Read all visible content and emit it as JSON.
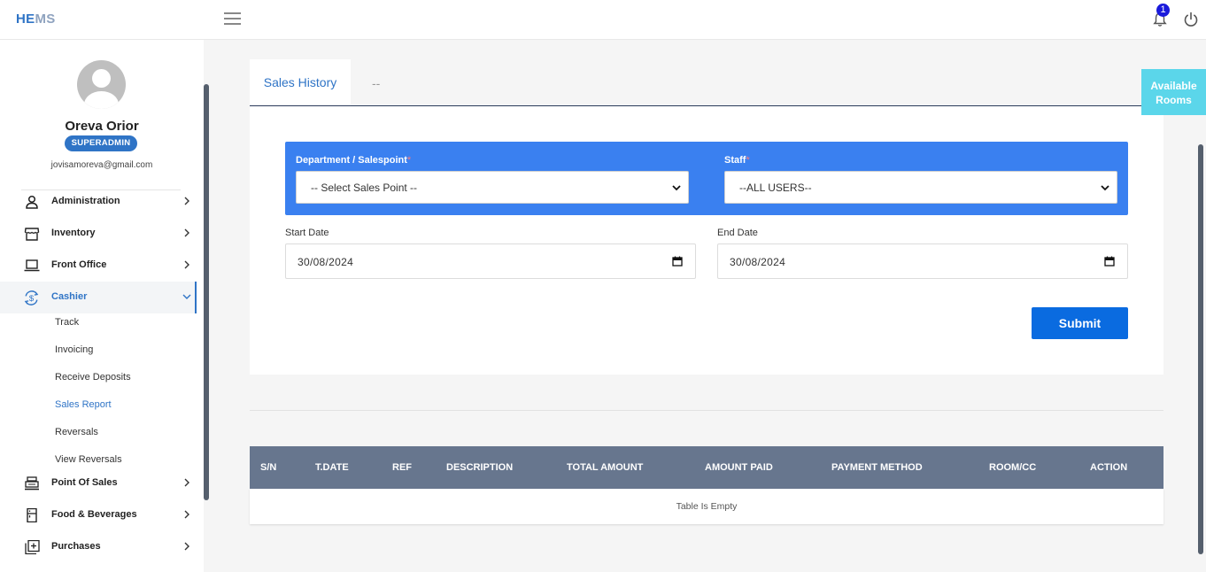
{
  "app": {
    "logo_he": "HE",
    "logo_ms": "MS"
  },
  "header": {
    "notification_count": "1"
  },
  "user": {
    "name": "Oreva Orior",
    "role": "SUPERADMIN",
    "email": "jovisamoreva@gmail.com"
  },
  "sidebar": {
    "items": [
      {
        "label": "Administration",
        "icon": "user-icon"
      },
      {
        "label": "Inventory",
        "icon": "store-icon"
      },
      {
        "label": "Front Office",
        "icon": "laptop-icon"
      },
      {
        "label": "Cashier",
        "icon": "currency-exchange-icon"
      },
      {
        "label": "Point Of Sales",
        "icon": "cash-register-icon"
      },
      {
        "label": "Food & Beverages",
        "icon": "fridge-icon"
      },
      {
        "label": "Purchases",
        "icon": "add-box-icon"
      }
    ],
    "cashier_sub": [
      "Track",
      "Invoicing",
      "Receive Deposits",
      "Sales Report",
      "Reversals",
      "View Reversals"
    ],
    "active_sub": "Sales Report"
  },
  "tabs": {
    "tab1": "Sales History",
    "tab2": "--"
  },
  "available_rooms": "Available Rooms",
  "form": {
    "department_label": "Department / Salespoint",
    "department_value": "-- Select Sales Point --",
    "staff_label": "Staff",
    "staff_value": "--ALL USERS--",
    "required_mark": "*",
    "start_date_label": "Start Date",
    "start_date_value": "30/08/2024",
    "end_date_label": "End Date",
    "end_date_value": "30/08/2024",
    "submit_label": "Submit"
  },
  "table": {
    "columns": [
      "S/N",
      "T.DATE",
      "REF",
      "DESCRIPTION",
      "TOTAL AMOUNT",
      "AMOUNT PAID",
      "PAYMENT METHOD",
      "ROOM/CC",
      "ACTION"
    ],
    "empty_message": "Table Is Empty"
  },
  "colors": {
    "primary": "#2f74c6",
    "panel_blue": "#3a80f0",
    "submit": "#0a6be0",
    "table_header": "#67768e",
    "available_rooms": "#5bd6ea",
    "badge": "#1a1adb"
  }
}
